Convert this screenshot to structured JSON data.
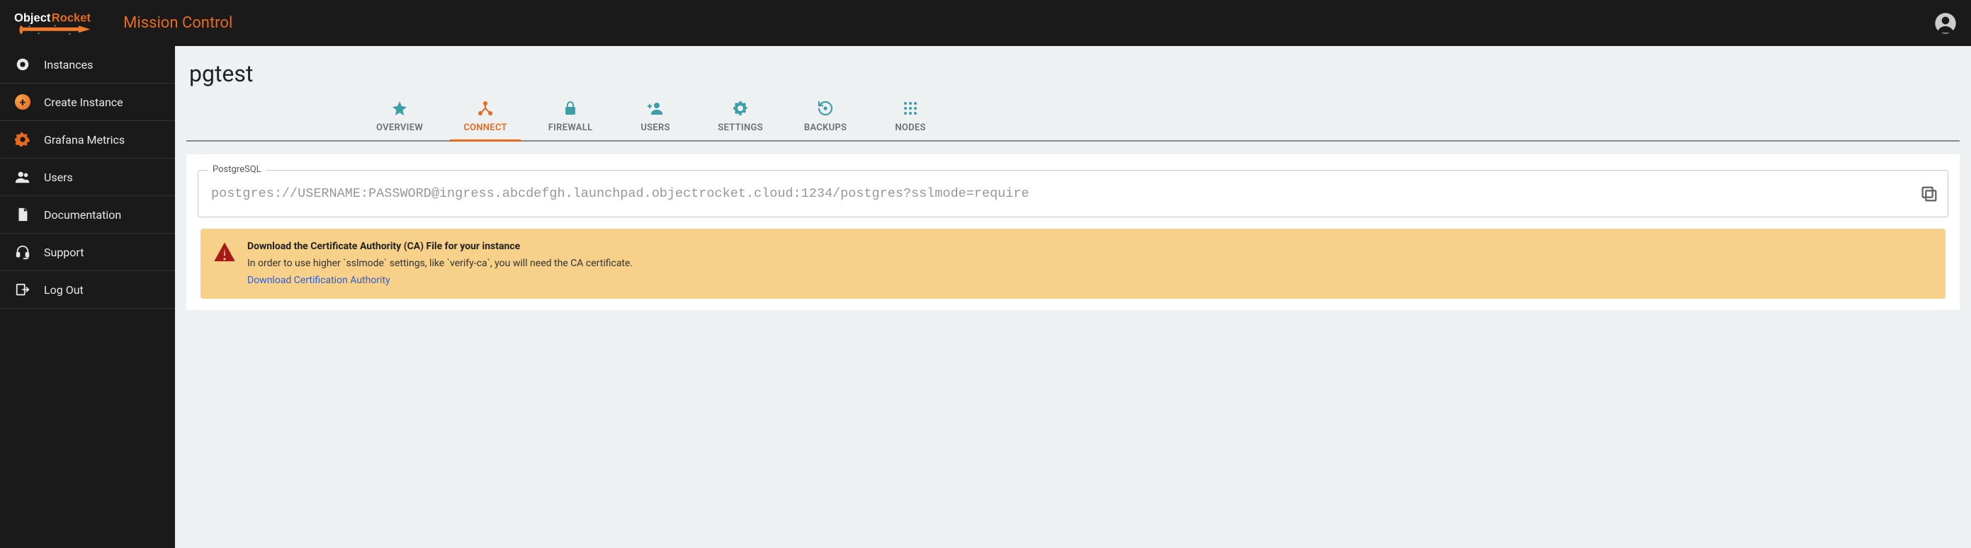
{
  "header": {
    "brand_primary": "Object",
    "brand_secondary": "Rocket",
    "subtitle": "Mission Control"
  },
  "sidebar": {
    "items": [
      {
        "label": "Instances"
      },
      {
        "label": "Create Instance"
      },
      {
        "label": "Grafana Metrics"
      },
      {
        "label": "Users"
      },
      {
        "label": "Documentation"
      },
      {
        "label": "Support"
      },
      {
        "label": "Log Out"
      }
    ]
  },
  "page": {
    "title": "pgtest"
  },
  "tabs": [
    {
      "label": "OVERVIEW"
    },
    {
      "label": "CONNECT"
    },
    {
      "label": "FIREWALL"
    },
    {
      "label": "USERS"
    },
    {
      "label": "SETTINGS"
    },
    {
      "label": "BACKUPS"
    },
    {
      "label": "NODES"
    }
  ],
  "connect": {
    "fieldset_label": "PostgreSQL",
    "connection_string": "postgres://USERNAME:PASSWORD@ingress.abcdefgh.launchpad.objectrocket.cloud:1234/postgres?sslmode=require"
  },
  "alert": {
    "title": "Download the Certificate Authority (CA) File for your instance",
    "body": "In order to use higher `sslmode` settings, like `verify-ca`, you will need the CA certificate.",
    "link_text": "Download Certification Authority"
  }
}
